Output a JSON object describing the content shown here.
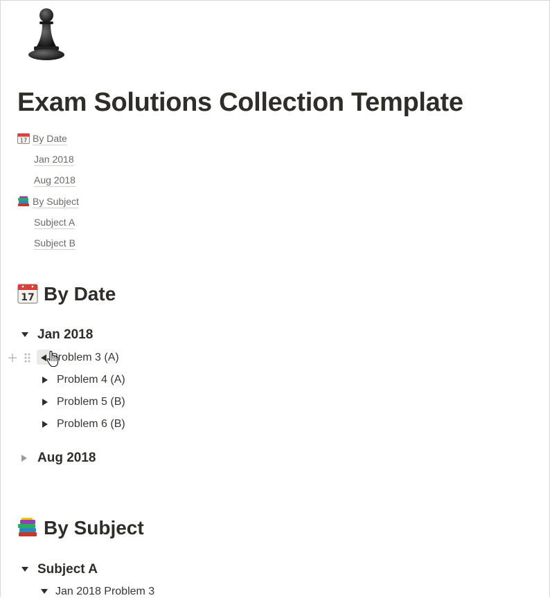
{
  "page": {
    "icon": "chess-pawn-icon",
    "title": "Exam Solutions Collection Template"
  },
  "toc": [
    {
      "label": "By Date",
      "icon": "calendar-icon"
    },
    {
      "label": "Jan 2018"
    },
    {
      "label": "Aug 2018"
    },
    {
      "label": "By Subject",
      "icon": "books-icon"
    },
    {
      "label": "Subject A"
    },
    {
      "label": "Subject B"
    }
  ],
  "sections": {
    "by_date": {
      "heading": "By Date",
      "icon": "calendar-icon",
      "groups": [
        {
          "label": "Jan 2018",
          "expanded": true,
          "items": [
            "Problem 3 (A)",
            "Problem 4 (A)",
            "Problem 5 (B)",
            "Problem 6 (B)"
          ]
        },
        {
          "label": "Aug 2018",
          "expanded": false
        }
      ]
    },
    "by_subject": {
      "heading": "By Subject",
      "icon": "books-icon",
      "groups": [
        {
          "label": "Subject A",
          "expanded": true,
          "items": [
            "Jan 2018 Problem 3"
          ]
        }
      ]
    }
  },
  "colors": {
    "text": "#37352f",
    "heading": "#2f2d29",
    "muted": "#6b6a66",
    "hover_bg": "#e9e9e7"
  }
}
